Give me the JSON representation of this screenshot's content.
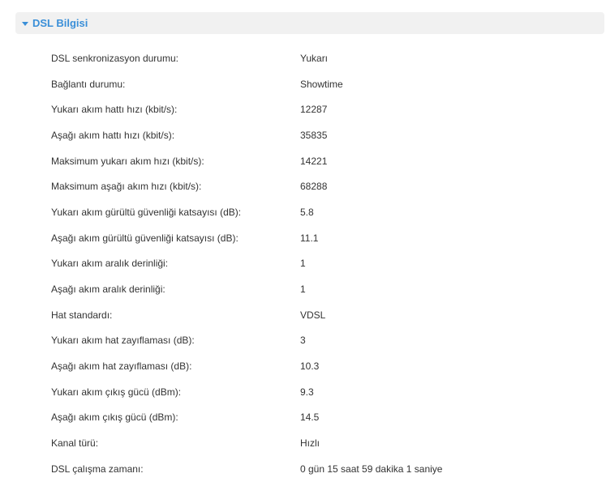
{
  "section": {
    "title": "DSL Bilgisi",
    "icon": "caret-down-icon",
    "accent_color": "#3a8fd8"
  },
  "rows": [
    {
      "label": "DSL senkronizasyon durumu:",
      "value": "Yukarı"
    },
    {
      "label": "Bağlantı durumu:",
      "value": "Showtime"
    },
    {
      "label": "Yukarı akım hattı hızı (kbit/s):",
      "value": "12287"
    },
    {
      "label": "Aşağı akım hattı hızı (kbit/s):",
      "value": "35835"
    },
    {
      "label": "Maksimum yukarı akım hızı (kbit/s):",
      "value": "14221"
    },
    {
      "label": "Maksimum aşağı akım hızı (kbit/s):",
      "value": "68288"
    },
    {
      "label": "Yukarı akım gürültü güvenliği katsayısı (dB):",
      "value": "5.8"
    },
    {
      "label": "Aşağı akım gürültü güvenliği katsayısı (dB):",
      "value": "11.1"
    },
    {
      "label": "Yukarı akım aralık derinliği:",
      "value": "1"
    },
    {
      "label": "Aşağı akım aralık derinliği:",
      "value": "1"
    },
    {
      "label": "Hat standardı:",
      "value": "VDSL"
    },
    {
      "label": "Yukarı akım hat zayıflaması (dB):",
      "value": "3"
    },
    {
      "label": "Aşağı akım hat zayıflaması (dB):",
      "value": "10.3"
    },
    {
      "label": "Yukarı akım çıkış gücü (dBm):",
      "value": "9.3"
    },
    {
      "label": "Aşağı akım çıkış gücü (dBm):",
      "value": "14.5"
    },
    {
      "label": "Kanal türü:",
      "value": "Hızlı"
    },
    {
      "label": "DSL çalışma zamanı:",
      "value": "0 gün 15 saat 59 dakika 1 saniye"
    }
  ]
}
